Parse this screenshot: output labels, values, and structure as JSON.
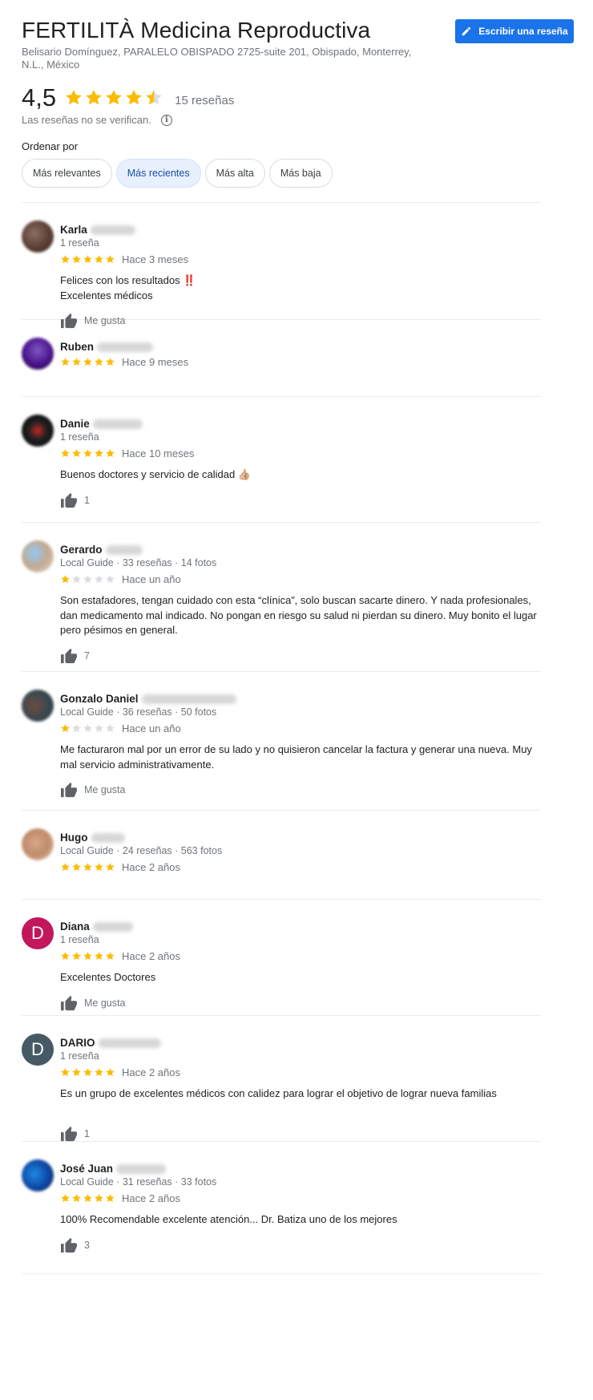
{
  "place": {
    "title": "FERTILITÀ Medicina Reproductiva",
    "address": "Belisario Domínguez, PARALELO OBISPADO 2725-suite 201, Obispado, Monterrey, N.L., México",
    "write_review_label": "Escribir una reseña",
    "rating": "4,5",
    "rating_value": 4.5,
    "review_count": "15 reseñas",
    "unverified_note": "Las reseñas no se verifican.",
    "info_glyph": "i"
  },
  "sort": {
    "label": "Ordenar por",
    "options": [
      "Más relevantes",
      "Más recientes",
      "Más alta",
      "Más baja"
    ],
    "selected": "Más recientes"
  },
  "colors": {
    "accent": "#1a73e8",
    "star": "#fbbc04",
    "star_empty": "#dadce0",
    "avatar_diana": "#c2185b",
    "avatar_dario": "#455a64"
  },
  "reviews": [
    {
      "name": "Karla",
      "meta": "1 reseña",
      "stars": 5,
      "date": "Hace 3 meses",
      "text": [
        "Felices con los resultados ‼️",
        "Excelentes médicos"
      ],
      "like": "Me gusta",
      "avatar_icon": "user-photo-icon"
    },
    {
      "name": "Ruben",
      "meta": "",
      "stars": 5,
      "date": "Hace 9 meses",
      "text": [],
      "like": "",
      "avatar_icon": "user-photo-icon"
    },
    {
      "name": "Danie",
      "meta": "1 reseña",
      "stars": 5,
      "date": "Hace 10 meses",
      "text": [
        "Buenos doctores y servicio de calidad 👍🏼"
      ],
      "like": "1",
      "avatar_icon": "user-photo-icon"
    },
    {
      "name": "Gerardo",
      "meta": "Local Guide · 33 reseñas · 14 fotos",
      "stars": 1,
      "date": "Hace un año",
      "text": [
        "Son estafadores, tengan cuidado con esta “clínica”, solo buscan sacarte dinero. Y nada profesionales, dan medicamento mal indicado. No pongan en riesgo su salud ni pierdan su dinero. Muy bonito el lugar pero pésimos en general."
      ],
      "like": "7",
      "avatar_icon": "user-photo-icon"
    },
    {
      "name": "Gonzalo Daniel",
      "meta": "Local Guide · 36 reseñas · 50 fotos",
      "stars": 1,
      "date": "Hace un año",
      "text": [
        "Me facturaron mal por un error de su lado y no quisieron cancelar la factura y generar una nueva. Muy mal servicio administrativamente."
      ],
      "like": "Me gusta",
      "avatar_icon": "user-photo-icon"
    },
    {
      "name": "Hugo",
      "meta": "Local Guide · 24 reseñas · 563 fotos",
      "stars": 5,
      "date": "Hace 2 años",
      "text": [],
      "like": "",
      "avatar_icon": "user-photo-icon"
    },
    {
      "name": "Diana",
      "meta": "1 reseña",
      "stars": 5,
      "date": "Hace 2 años",
      "text": [
        "Excelentes Doctores"
      ],
      "like": "Me gusta",
      "avatar_letter": "D"
    },
    {
      "name": "DARIO",
      "meta": "1 reseña",
      "stars": 5,
      "date": "Hace 2 años",
      "text": [
        "Es un grupo de excelentes médicos con calidez para lograr el objetivo de lograr nueva familias"
      ],
      "like": "1",
      "avatar_letter": "D"
    },
    {
      "name": "José Juan",
      "meta": "Local Guide · 31 reseñas · 33 fotos",
      "stars": 5,
      "date": "Hace 2 años",
      "text": [
        "100% Recomendable excelente atención... Dr. Batiza uno de los mejores"
      ],
      "like": "3",
      "avatar_icon": "user-photo-icon"
    }
  ]
}
